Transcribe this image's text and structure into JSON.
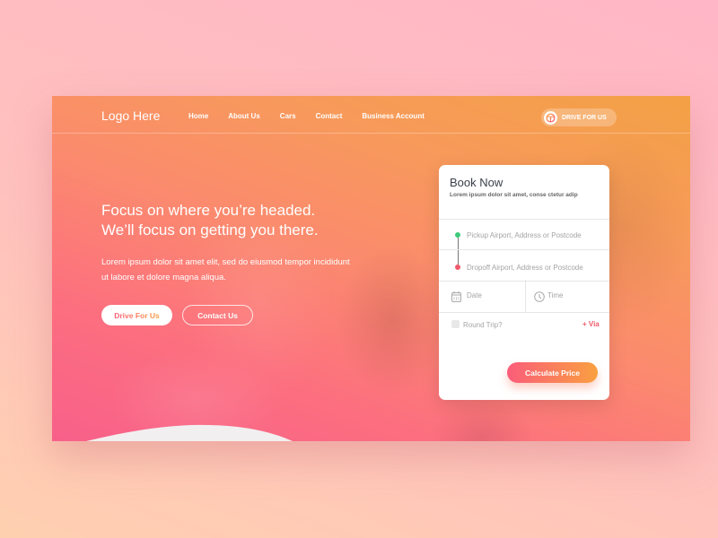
{
  "nav": {
    "logo": "Logo Here",
    "links": [
      "Home",
      "About Us",
      "Cars",
      "Contact",
      "Business Account"
    ],
    "drive_button": "DRIVE FOR US",
    "drive_icon": "steering-wheel-icon"
  },
  "hero": {
    "title_line1": "Focus on where you’re headed.",
    "title_line2": "We’ll focus on getting you there.",
    "subtitle": "Lorem ipsum dolor sit amet elit, sed do eiusmod tempor incididunt ut labore et dolore magna aliqua.",
    "primary_button": "Drive For Us",
    "secondary_button": "Contact Us"
  },
  "booking": {
    "title": "Book Now",
    "subtitle": "Lorem ipsum dolor sit amet, conse ctetur adip",
    "pickup_placeholder": "Pickup Airport, Address or Postcode",
    "dropoff_placeholder": "Dropoff Airport, Address or Postcode",
    "date_placeholder": "Date",
    "time_placeholder": "Time",
    "round_trip_label": "Round Trip?",
    "round_trip_checked": false,
    "via_label": "+ Via",
    "calculate_button": "Calculate Price"
  },
  "colors": {
    "pickup_dot": "#3ec97a",
    "dropoff_dot": "#f05a6a",
    "accent_start": "#fb5d7a",
    "accent_end": "#f9a040"
  }
}
